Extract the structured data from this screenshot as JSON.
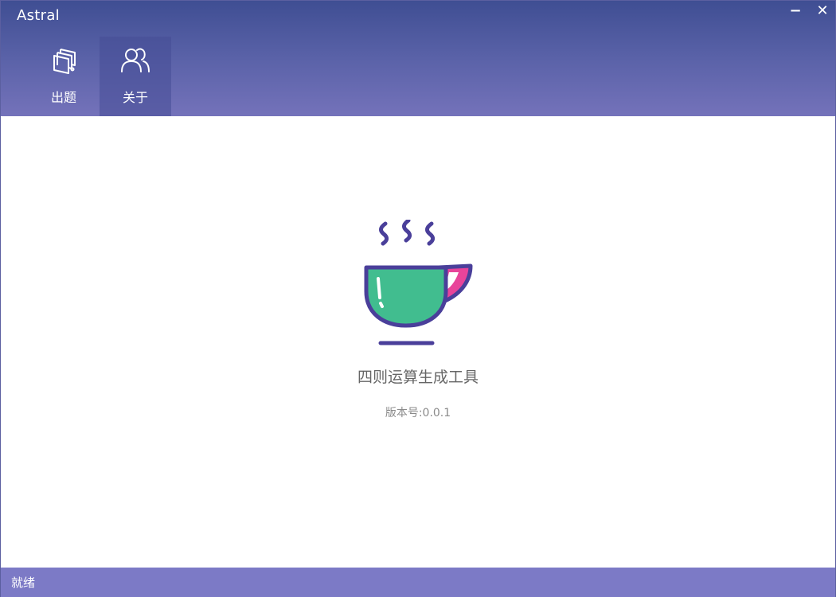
{
  "window": {
    "title": "Astral",
    "minimize_glyph": "−",
    "close_glyph": "✕"
  },
  "nav": {
    "items": [
      {
        "label": "出题",
        "icon": "cards-stack-icon",
        "active": false
      },
      {
        "label": "关于",
        "icon": "users-icon",
        "active": true
      }
    ]
  },
  "about": {
    "illustration": "coffee-cup-icon",
    "product_name": "四则运算生成工具",
    "version_text": "版本号:0.0.1"
  },
  "statusbar": {
    "text": "就绪"
  },
  "colors": {
    "titlebar_top": "#3f4e93",
    "titlebar_bottom": "#7472ba",
    "statusbar": "#7c7ac6",
    "cup_outline": "#4a3f9a",
    "cup_fill": "#41bd8f",
    "cup_handle_accent": "#e8449a"
  }
}
